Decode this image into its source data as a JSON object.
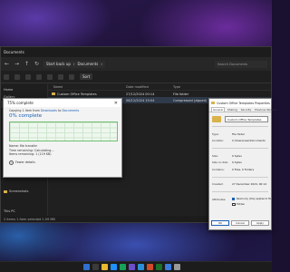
{
  "explorer": {
    "title": "Documents",
    "breadcrumb": [
      "Start back up",
      "Documents"
    ],
    "search_placeholder": "Search Documents",
    "sort_label": "Sort",
    "nav_items": [
      {
        "label": "Home"
      },
      {
        "label": "Gallery"
      },
      {
        "label": "Documents"
      },
      {
        "label": "Screenshots"
      },
      {
        "label": "This PC"
      },
      {
        "label": "Network"
      }
    ],
    "columns": {
      "name": "Name",
      "date": "Date modified",
      "type": "Type"
    },
    "rows": [
      {
        "name": "Custom Office Templates",
        "date": "27/12/2024 00:14",
        "type": "File folder"
      },
      {
        "name": "",
        "date": "06/12/2024 19:04",
        "type": "Compressed (zipped)"
      }
    ],
    "status": "2 items  1 item selected  1.09 MB"
  },
  "copy_dialog": {
    "title": "75% complete",
    "line1_prefix": "Copying 1 item from",
    "line1_source": "Downloads",
    "line1_mid": "to",
    "line1_dest": "Documents",
    "percent": "0% complete",
    "name_line": "Name: file transfer",
    "time_line": "Time remaining: Calculating...",
    "items_line": "Items remaining: 1 (119 KB)",
    "fewer_details": "Fewer details"
  },
  "properties": {
    "title": "Custom Office Templates Properties",
    "tabs": [
      "General",
      "Sharing",
      "Security",
      "Previous Versions"
    ],
    "name_value": "Custom Office Templates",
    "rows": [
      {
        "label": "Type:",
        "value": "File folder"
      },
      {
        "label": "Location:",
        "value": "C:\\Users\\user\\Documents"
      },
      {
        "label": "Size:",
        "value": "0 bytes"
      },
      {
        "label": "Size on disk:",
        "value": "0 bytes"
      },
      {
        "label": "Contains:",
        "value": "0 Files, 0 Folders"
      },
      {
        "label": "Created:",
        "value": "27 December 2024, 00:14"
      },
      {
        "label": "Attributes:",
        "value": ""
      }
    ],
    "attr_readonly": "Read-only (Only applies to files in folder)",
    "attr_hidden": "Hidden",
    "buttons": {
      "ok": "OK",
      "cancel": "Cancel",
      "apply": "Apply"
    }
  },
  "taskbar": {
    "icon_colors": [
      "#2f6fd0",
      "#3a3a3a",
      "#e8b830",
      "#1e90ff",
      "#18a058",
      "#6b4fc8",
      "#2a8fd8",
      "#d04a2a",
      "#1a6f2a",
      "#3a7be0",
      "#999999"
    ]
  }
}
